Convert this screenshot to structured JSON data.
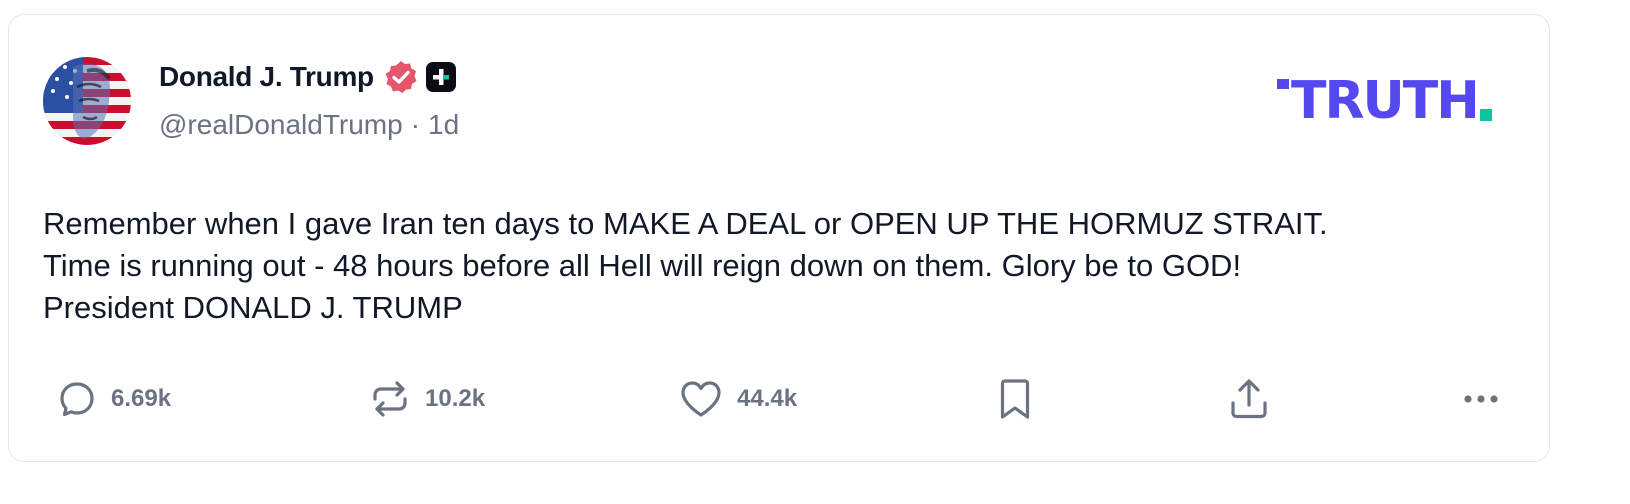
{
  "post": {
    "author": {
      "display_name": "Donald J. Trump",
      "handle": "@realDonaldTrump",
      "time": "1d",
      "separator": "·"
    },
    "brand": {
      "logo_text": "TRUTH",
      "color": "#5448ee",
      "accent": "#0ec5a1"
    },
    "body_lines": [
      "Remember when I gave Iran ten days to MAKE A DEAL or OPEN UP THE HORMUZ STRAIT.",
      "Time is running out - 48 hours before all Hell will reign down on them. Glory be to GOD!",
      "President DONALD J. TRUMP"
    ],
    "actions": {
      "reply_count": "6.69k",
      "repost_count": "10.2k",
      "like_count": "44.4k"
    },
    "icons": {
      "verified": "verified-badge-icon",
      "plus": "truth-plus-icon",
      "reply": "reply-icon",
      "repost": "repost-icon",
      "like": "heart-icon",
      "bookmark": "bookmark-icon",
      "share": "share-icon",
      "more": "more-icon"
    }
  }
}
